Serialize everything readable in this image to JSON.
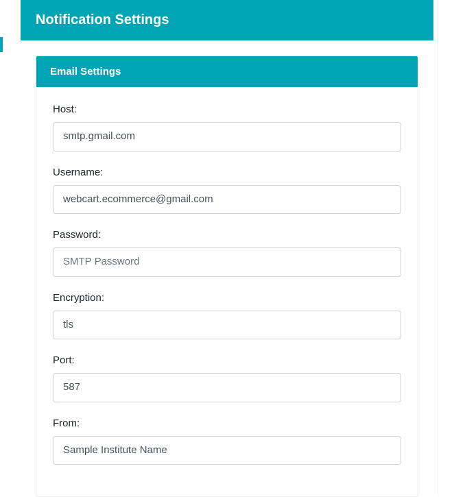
{
  "page": {
    "title": "Notification Settings"
  },
  "card": {
    "title": "Email Settings"
  },
  "form": {
    "host": {
      "label": "Host:",
      "value": "smtp.gmail.com"
    },
    "username": {
      "label": "Username:",
      "value": "webcart.ecommerce@gmail.com"
    },
    "password": {
      "label": "Password:",
      "value": "",
      "placeholder": "SMTP Password"
    },
    "encryption": {
      "label": "Encryption:",
      "value": "tls"
    },
    "port": {
      "label": "Port:",
      "value": "587"
    },
    "from": {
      "label": "From:",
      "value": "Sample Institute Name"
    }
  }
}
